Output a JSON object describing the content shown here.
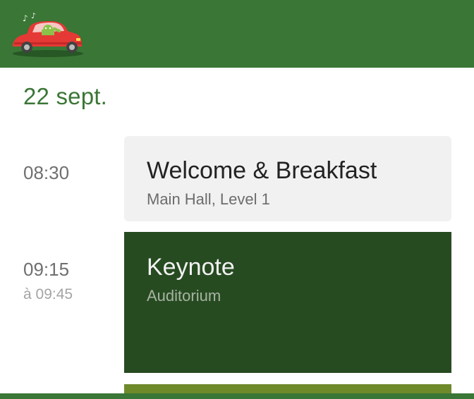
{
  "app": {
    "icon": "android-car-icon"
  },
  "schedule": {
    "date": "22 sept.",
    "slots": [
      {
        "time": "08:30",
        "end": "",
        "title": "Welcome & Breakfast",
        "room": "Main Hall, Level 1"
      },
      {
        "time": "09:15",
        "end": "à 09:45",
        "title": "Keynote",
        "room": "Auditorium"
      },
      {
        "time": "",
        "end": "",
        "title": "",
        "room": ""
      }
    ]
  },
  "colors": {
    "appbar": "#3a7636",
    "accent": "#3a7636",
    "session_light": "#f1f1f1",
    "session_dark": "#274b21",
    "session_olive": "#6f8a2b"
  }
}
